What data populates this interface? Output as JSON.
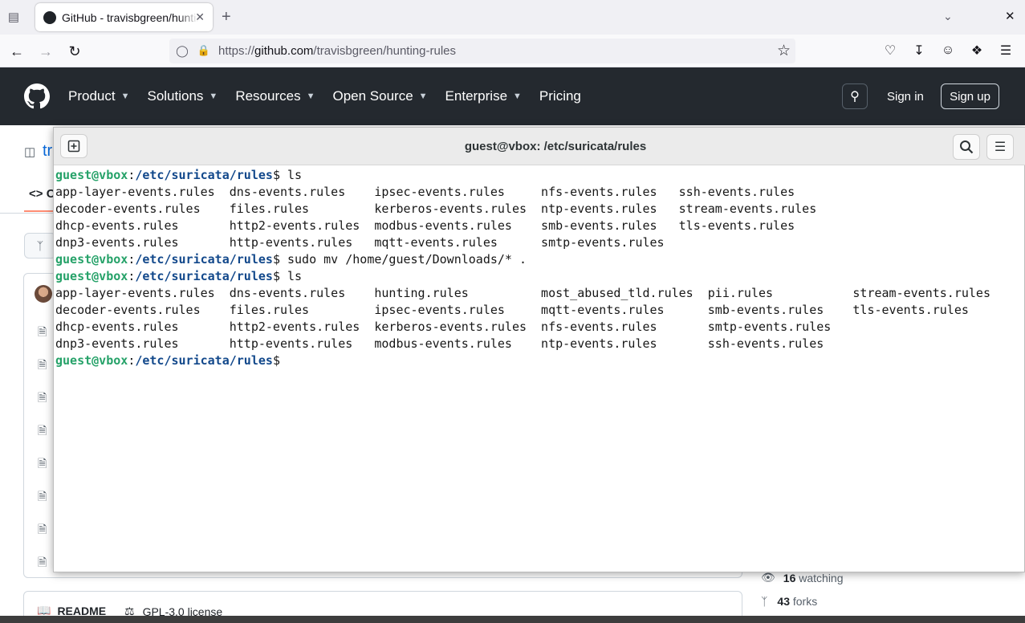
{
  "browser": {
    "tab_title": "GitHub - travisbgreen/hunting-rules",
    "url_prefix": "https://",
    "url_host": "github.com",
    "url_path": "/travisbgreen/hunting-rules"
  },
  "github": {
    "nav": [
      "Product",
      "Solutions",
      "Resources",
      "Open Source",
      "Enterprise",
      "Pricing"
    ],
    "nav_has_dropdown": [
      true,
      true,
      true,
      true,
      true,
      false
    ],
    "sign_in": "Sign in",
    "sign_up": "Sign up",
    "repo_partial": "tr",
    "code_tab_partial": "C",
    "watching_count": "16",
    "watching_label": "watching",
    "forks_count": "43",
    "forks_label": "forks",
    "readme": "README",
    "license": "GPL-3.0 license"
  },
  "terminal": {
    "title": "guest@vbox: /etc/suricata/rules",
    "prompt_user": "guest@vbox",
    "prompt_path": "/etc/suricata/rules",
    "lines": [
      {
        "type": "prompt",
        "cmd": " ls"
      },
      {
        "type": "out",
        "text": "app-layer-events.rules  dns-events.rules    ipsec-events.rules     nfs-events.rules   ssh-events.rules"
      },
      {
        "type": "out",
        "text": "decoder-events.rules    files.rules         kerberos-events.rules  ntp-events.rules   stream-events.rules"
      },
      {
        "type": "out",
        "text": "dhcp-events.rules       http2-events.rules  modbus-events.rules    smb-events.rules   tls-events.rules"
      },
      {
        "type": "out",
        "text": "dnp3-events.rules       http-events.rules   mqtt-events.rules      smtp-events.rules"
      },
      {
        "type": "prompt",
        "cmd": " sudo mv /home/guest/Downloads/* ."
      },
      {
        "type": "prompt",
        "cmd": " ls"
      },
      {
        "type": "out",
        "text": "app-layer-events.rules  dns-events.rules    hunting.rules          most_abused_tld.rules  pii.rules           stream-events.rules"
      },
      {
        "type": "out",
        "text": "decoder-events.rules    files.rules         ipsec-events.rules     mqtt-events.rules      smb-events.rules    tls-events.rules"
      },
      {
        "type": "out",
        "text": "dhcp-events.rules       http2-events.rules  kerberos-events.rules  nfs-events.rules       smtp-events.rules"
      },
      {
        "type": "out",
        "text": "dnp3-events.rules       http-events.rules   modbus-events.rules    ntp-events.rules       ssh-events.rules"
      },
      {
        "type": "prompt",
        "cmd": ""
      }
    ]
  }
}
